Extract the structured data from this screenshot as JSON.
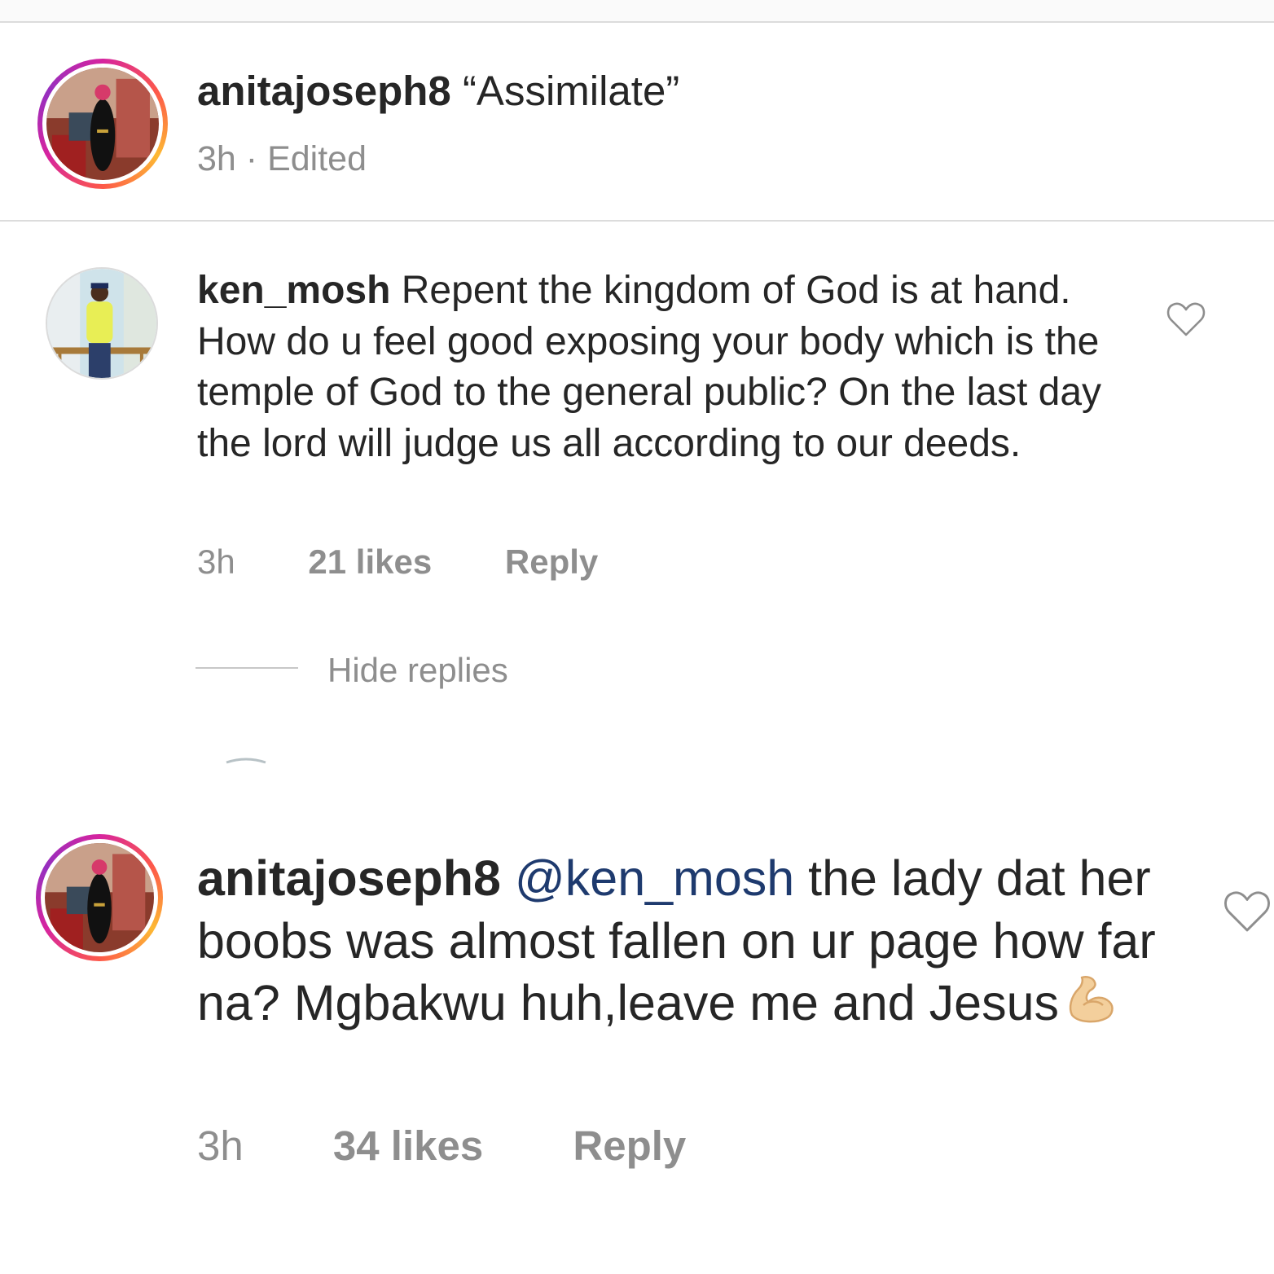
{
  "comments": [
    {
      "username": "anitajoseph8",
      "text": "“Assimilate”",
      "time": "3h",
      "separator": "·",
      "status": "Edited",
      "avatar_icon": "profile-photo-story-ring"
    },
    {
      "username": "ken_mosh",
      "text": "Repent the kingdom of God is at hand. How do u feel good exposing your body which is the temple of God to the general public? On the last day the lord will judge us all according to our deeds.",
      "time": "3h",
      "likes": "21 likes",
      "reply_label": "Reply",
      "like_icon": "heart-outline-icon"
    },
    {
      "username": "anitajoseph8",
      "mention": "@ken_mosh",
      "text": "the lady dat her boobs was almost fallen on ur page how far na? Mgbakwu huh,leave me and Jesus",
      "emoji": "flexed-biceps-emoji",
      "time": "3h",
      "likes": "34 likes",
      "reply_label": "Reply",
      "like_icon": "heart-outline-icon"
    }
  ],
  "replies_toggle": {
    "label": "Hide replies"
  },
  "colors": {
    "text": "#262626",
    "meta": "#8e8e8e",
    "mention": "#1e3a6e",
    "divider": "#dcdcdc",
    "ring_pink": "#d6249f",
    "ring_orange": "#fd5949",
    "ring_yellow": "#fdb933"
  }
}
